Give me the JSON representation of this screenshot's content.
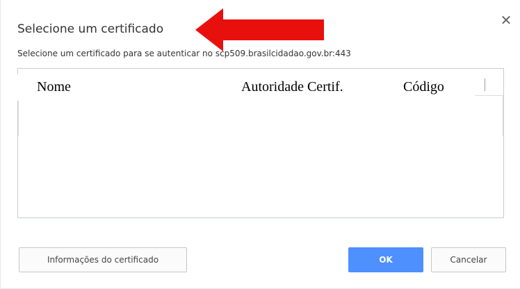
{
  "dialog": {
    "title": "Selecione um certificado",
    "subtitle": "Selecione um certificado para se autenticar no scp509.brasilcidadao.gov.br:443",
    "close_icon": "close-icon",
    "annotation_icon": "red-arrow-icon",
    "annotation_color": "#e8100c"
  },
  "table": {
    "columns": [
      "Nome",
      "Autoridade Certif.",
      "Código"
    ],
    "rows": []
  },
  "buttons": {
    "info_label": "Informações do certificado",
    "ok_label": "OK",
    "cancel_label": "Cancelar",
    "ok_color": "#4d90fe"
  }
}
